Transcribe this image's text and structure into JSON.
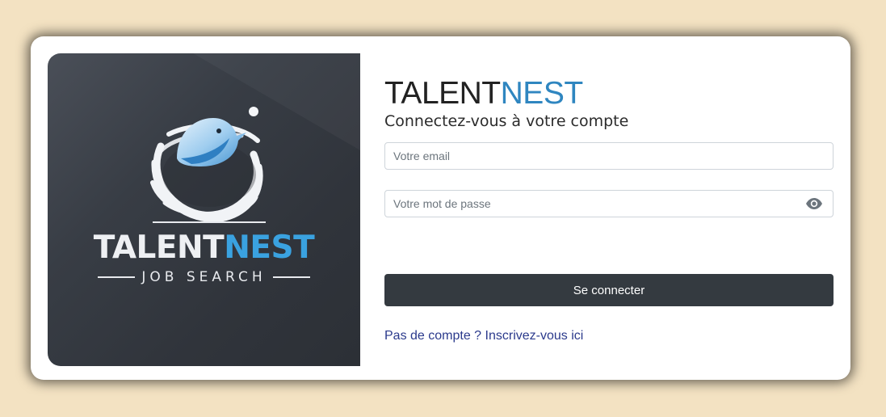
{
  "logo": {
    "word_part1": "TALENT",
    "word_part2": "NEST",
    "tagline": "JOB SEARCH",
    "icon": "bird-nest-icon"
  },
  "header": {
    "brand_part1": "TALENT",
    "brand_part2": "NEST",
    "subtitle": "Connectez-vous à votre compte"
  },
  "form": {
    "email_placeholder": "Votre email",
    "email_value": "",
    "password_placeholder": "Votre mot de passe",
    "password_value": "",
    "password_toggle_icon": "eye-icon",
    "submit_label": "Se connecter",
    "signup_link": "Pas de compte ? Inscrivez-vous ici"
  },
  "colors": {
    "background": "#f3e2c2",
    "brand_accent": "#2f86c0",
    "button": "#343a40",
    "link": "#2b3a8c"
  }
}
